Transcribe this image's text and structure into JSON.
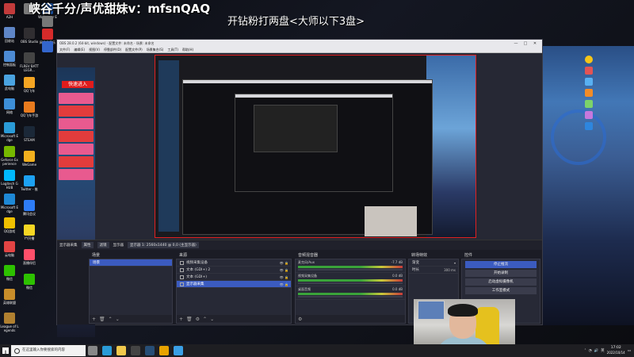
{
  "overlay": {
    "title": "峡谷千分/声优甜妹v：mfsnQAQ",
    "subtitle": "开钻粉打两盘<大师以下3盘>"
  },
  "desktop_icons_left": [
    {
      "label": "A2H",
      "color": "#c23b3b"
    },
    {
      "label": "回收站",
      "color": "#5f86c7"
    },
    {
      "label": "控制面板",
      "color": "#4c8ad3"
    },
    {
      "label": "此电脑",
      "color": "#4aa3e0"
    },
    {
      "label": "网络",
      "color": "#3d8fd8"
    },
    {
      "label": "Microsoft Edge",
      "color": "#2a9bd7"
    },
    {
      "label": "Geforce Experience",
      "color": "#76b900"
    },
    {
      "label": "Logitech G HUB",
      "color": "#00b8fc"
    },
    {
      "label": "Microsoft Edge",
      "color": "#1e88d6"
    },
    {
      "label": "QQ游戏",
      "color": "#f0c000"
    },
    {
      "label": "云电脑",
      "color": "#e24444"
    },
    {
      "label": "微信",
      "color": "#2dc100"
    },
    {
      "label": "英雄联盟",
      "color": "#c88d2a"
    },
    {
      "label": "League of Legends",
      "color": "#b08030"
    }
  ],
  "desktop_icons_right": [
    {
      "label": "",
      "color": "#7a7a7a"
    },
    {
      "label": "OBS Studio",
      "color": "#302e31"
    },
    {
      "label": "FLREV BATTLEGR...",
      "color": "#444"
    },
    {
      "label": "QQ飞车",
      "color": "#f5a623"
    },
    {
      "label": "QQ飞车手游",
      "color": "#e97b1e"
    },
    {
      "label": "STEAM",
      "color": "#1b2838"
    },
    {
      "label": "WeGame",
      "color": "#f2b01e"
    },
    {
      "label": "Twitter - 推",
      "color": "#1da1f2"
    },
    {
      "label": "腾讯会议",
      "color": "#2e7cf6"
    },
    {
      "label": "YY开播",
      "color": "#f5d623"
    },
    {
      "label": "直播伴侣",
      "color": "#ff4f6a"
    },
    {
      "label": "微信",
      "color": "#2dc100"
    }
  ],
  "desktop_icons_col3": [
    {
      "label": "Wallpaper Engine",
      "color": "#1a4f9c"
    },
    {
      "label": "",
      "color": "#777"
    },
    {
      "label": "网易云音乐",
      "color": "#d62a2a"
    },
    {
      "label": "",
      "color": "#3366cc"
    }
  ],
  "obs": {
    "window_title": "OBS 28.0.2 (64-bit, windows) - 配置文件: 未命名 - 场景: 未命名",
    "menu": [
      "文件(F)",
      "编辑(E)",
      "视图(V)",
      "停靠部件(D)",
      "配置文件(P)",
      "场景集合(S)",
      "工具(T)",
      "帮助(H)"
    ],
    "promo_label": "快速进入",
    "source_toolbar": {
      "source": "显示器采集",
      "props": "属性",
      "filters": "滤镜",
      "display_label": "显示器",
      "display_value": "显示器 1: 2560x1440 @ 0,0 (主显示器)"
    },
    "scenes": {
      "header": "场景",
      "items": [
        "场景"
      ],
      "selected": 0
    },
    "sources": {
      "header": "来源",
      "items": [
        "视频采集设备",
        "文本 (GDI+) 2",
        "文本 (GDI+)",
        "显示器采集"
      ],
      "selected": 3
    },
    "mixer": {
      "header": "音频混音器",
      "channels": [
        {
          "name": "麦克风/Aux",
          "value": "-7.7 dB"
        },
        {
          "name": "视频采集设备",
          "value": "0.0 dB"
        },
        {
          "name": "桌面音频",
          "value": "0.0 dB"
        }
      ]
    },
    "transitions": {
      "header": "转场特效",
      "type": "渐变",
      "duration_label": "时长",
      "duration_value": "300 ms"
    },
    "controls": {
      "header": "控件",
      "buttons": [
        "停止推流",
        "开始录制",
        "启动虚拟摄像机",
        "工作室模式"
      ],
      "active": 0
    }
  },
  "taskbar": {
    "search_placeholder": "在这里输入你要搜索的内容",
    "time": "17:02",
    "date": "2022/10/14",
    "lang": "英",
    "apps": [
      {
        "name": "task-view",
        "color": "#888"
      },
      {
        "name": "edge",
        "color": "#2a9bd7"
      },
      {
        "name": "explorer",
        "color": "#f2c94c"
      },
      {
        "name": "obs",
        "color": "#444"
      },
      {
        "name": "steam",
        "color": "#274e76"
      },
      {
        "name": "wegame",
        "color": "#e8a300"
      },
      {
        "name": "qq",
        "color": "#3aa0e6"
      }
    ]
  }
}
